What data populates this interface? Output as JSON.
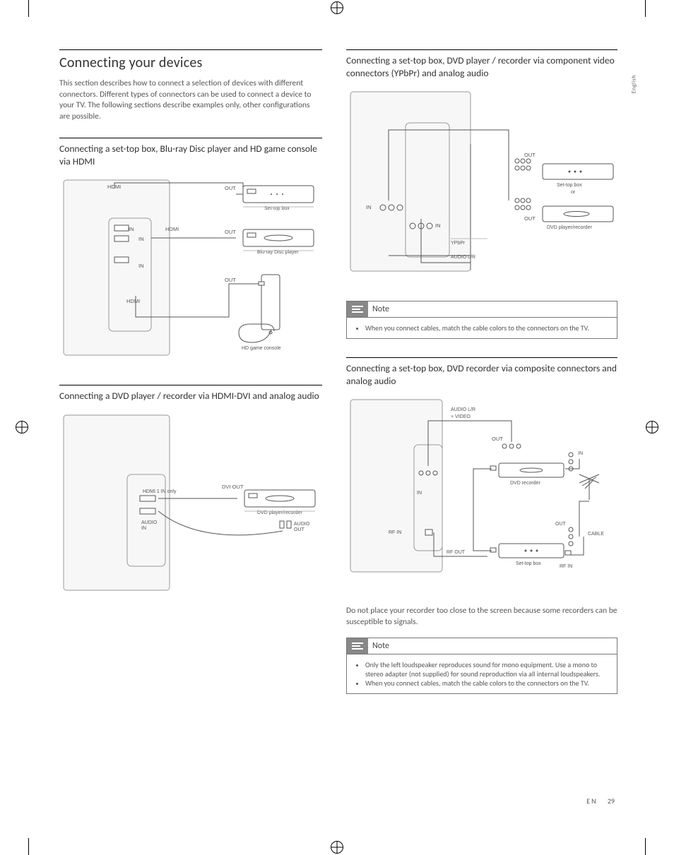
{
  "language_tab": "English",
  "footer": {
    "lang": "EN",
    "page": "29"
  },
  "left": {
    "heading": "Connecting your devices",
    "intro": "This section describes how to connect a selection of devices with different connectors. Different types of connectors can be used to connect a device to your TV. The following sections describe examples only, other configurations are possible.",
    "sec1": {
      "title": "Connecting a set-top box, Blu-ray Disc player and HD game console via HDMI",
      "labels": {
        "hdmi": "HDMI",
        "in": "IN",
        "out": "OUT",
        "settop": "Set-top box",
        "bluray": "Blu-ray Disc player",
        "console": "HD game console"
      }
    },
    "sec2": {
      "title": "Connecting a DVD player / recorder via HDMI-DVI and analog audio",
      "labels": {
        "hdmi1": "HDMI 1 IN only",
        "dviout": "DVI OUT",
        "dvd": "DVD player/recorder",
        "audio_in": "AUDIO\nIN",
        "audio_out": "AUDIO\nOUT"
      }
    }
  },
  "right": {
    "sec1": {
      "title": "Connecting a set-top box, DVD player / recorder via component video connectors (YPbPr) and analog audio",
      "labels": {
        "in": "IN",
        "out": "OUT",
        "settop_or": "Set-top box\nor",
        "dvd": "DVD player/recorder",
        "ypbpr": "YPbPr",
        "audiolr": "AUDIO L/R"
      }
    },
    "note1": {
      "title": "Note",
      "items": [
        "When you connect cables, match the cable colors to the connectors on the TV."
      ]
    },
    "sec2": {
      "title": "Connecting a set-top box, DVD recorder via composite connectors and analog audio",
      "labels": {
        "audiolr_video": "AUDIO L/R\n+ VIDEO",
        "out": "OUT",
        "in": "IN",
        "dvdrec": "DVD recorder",
        "rfin": "RF IN",
        "rfout": "RF OUT",
        "settop": "Set-top box",
        "cable": "CABLE"
      }
    },
    "body": "Do not place your recorder too close to the screen because some recorders can be susceptible to signals.",
    "note2": {
      "title": "Note",
      "items": [
        "Only the left loudspeaker reproduces sound for mono equipment. Use a mono to stereo adapter (not supplied) for sound reproduction via all internal loudspeakers.",
        "When you connect cables, match the cable colors to the connectors on the TV."
      ]
    }
  }
}
